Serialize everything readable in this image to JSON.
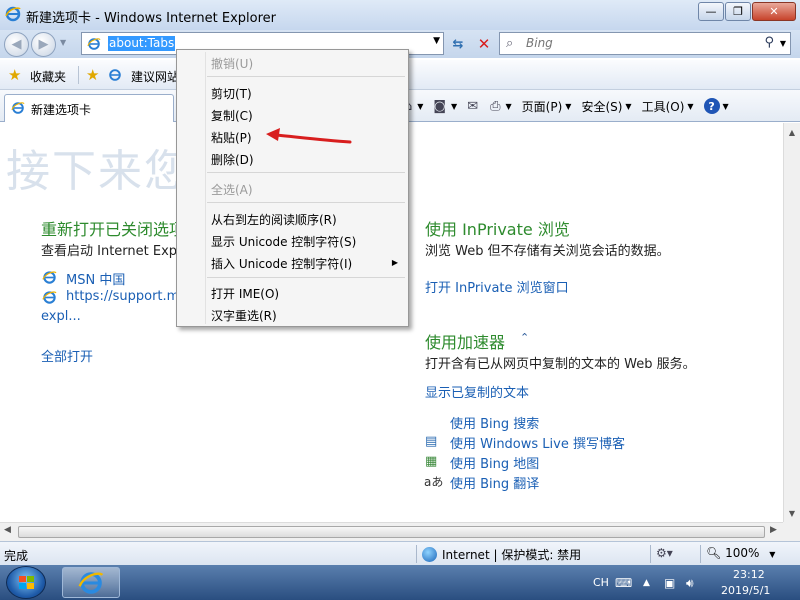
{
  "window": {
    "title": "新建选项卡 - Windows Internet Explorer",
    "buttons": {
      "minimize": "—",
      "maximize": "❐",
      "close": "✕"
    }
  },
  "nav": {
    "url": "about:Tabs",
    "search_placeholder": "Bing"
  },
  "favorites": {
    "label": "收藏夹",
    "suggested": "建议网站"
  },
  "tab": {
    "label": "新建选项卡"
  },
  "commands": {
    "page": "页面(P)",
    "safety": "安全(S)",
    "tools": "工具(O)"
  },
  "content": {
    "heading": "接下来您想做什么?",
    "reopen": {
      "title": "重新打开已关闭选项卡",
      "desc": "查看启动 Internet Explorer",
      "links": [
        "MSN 中国",
        "https://support.m",
        "expl..."
      ],
      "open_all": "全部打开"
    },
    "inprivate": {
      "title": "使用 InPrivate 浏览",
      "desc": "浏览 Web 但不存储有关浏览会话的数据。",
      "link": "打开 InPrivate 浏览窗口"
    },
    "accelerators": {
      "title": "使用加速器",
      "desc": "打开含有已从网页中复制的文本的 Web 服务。",
      "show_link": "显示已复制的文本",
      "items": [
        "使用 Bing 搜索",
        "使用 Windows Live 撰写博客",
        "使用 Bing 地图",
        "使用 Bing 翻译"
      ]
    }
  },
  "context_menu": {
    "undo": "撤销(U)",
    "cut": "剪切(T)",
    "copy": "复制(C)",
    "paste": "粘贴(P)",
    "delete": "删除(D)",
    "select_all": "全选(A)",
    "rtl": "从右到左的阅读顺序(R)",
    "show_unicode": "显示 Unicode 控制字符(S)",
    "insert_unicode": "插入 Unicode 控制字符(I)",
    "open_ime": "打开 IME(O)",
    "reconversion": "汉字重选(R)"
  },
  "status": {
    "text": "完成",
    "zone": "Internet | 保护模式: 禁用",
    "zoom": "100%"
  },
  "taskbar": {
    "lang": "CH",
    "time": "23:12",
    "date": "2019/5/1"
  },
  "colors": {
    "section_title": "#2e8b2e",
    "link": "#1a5fb4",
    "annotation_arrow": "#d81e1e"
  }
}
